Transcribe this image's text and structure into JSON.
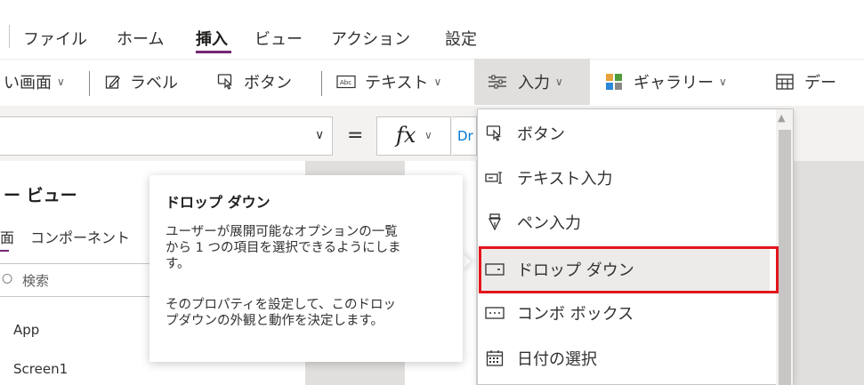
{
  "menu": {
    "items": [
      "ファイル",
      "ホーム",
      "挿入",
      "ビュー",
      "アクション",
      "設定"
    ],
    "active": "挿入",
    "accent_color": "#742774"
  },
  "ribbon": {
    "new_screen": "い画面",
    "label": "ラベル",
    "button": "ボタン",
    "text": "テキスト",
    "input": "入力",
    "gallery": "ギャラリー",
    "data": "デー"
  },
  "formula_bar": {
    "fx": "fx",
    "equals": "=",
    "formula_value": "Dr"
  },
  "left_panel": {
    "title": "ー ビュー",
    "tabs": [
      "面",
      "コンポーネント"
    ],
    "search_placeholder": "検索",
    "tree": [
      "App",
      "Screen1"
    ]
  },
  "tooltip": {
    "title": "ドロップ ダウン",
    "paragraph1": "ユーザーが展開可能なオプションの一覧\nから 1 つの項目を選択できるようにしま\nす。",
    "paragraph2": "そのプロパティを設定して、このドロッ\nプダウンの外観と動作を決定します。"
  },
  "dropdown": {
    "items": [
      {
        "label": "ボタン",
        "icon": "button-icon"
      },
      {
        "label": "テキスト入力",
        "icon": "text-input-icon"
      },
      {
        "label": "ペン入力",
        "icon": "pen-input-icon"
      },
      {
        "label": "ドロップ ダウン",
        "icon": "dropdown-icon"
      },
      {
        "label": "コンボ ボックス",
        "icon": "combo-box-icon"
      },
      {
        "label": "日付の選択",
        "icon": "calendar-icon"
      }
    ],
    "highlighted": "ドロップ ダウン",
    "highlight_color": "#e3161b"
  }
}
